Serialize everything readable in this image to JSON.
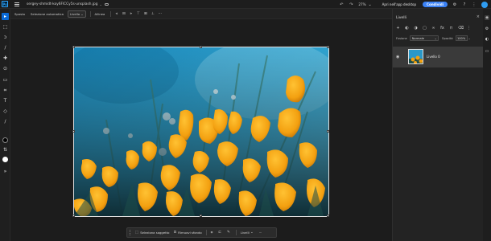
{
  "app": {
    "logo_text": "Ps"
  },
  "document": {
    "title": "sergey-shmidt-koy6FlCCy5s-unsplash.jpg"
  },
  "topbar": {
    "zoom": "27%",
    "desktop_button": "Apri nell'app desktop",
    "share_button": "Condividi"
  },
  "options_bar": {
    "items": [
      {
        "label": "Sposta"
      },
      {
        "label": "Selezione automatica"
      },
      {
        "label": "Livello"
      }
    ],
    "align_label": "Allinea",
    "more": "···"
  },
  "context_bar": {
    "select_subject": "Seleziona soggetto",
    "remove_background": "Rimuovi sfondo",
    "adjustments": "Livelli",
    "more": "···"
  },
  "layers_panel": {
    "title": "Livelli",
    "blend_label": "Fusione",
    "blend_mode": "Normale",
    "opacity_label": "Opacità",
    "opacity_value": "100%",
    "layer_name": "Livello 0"
  },
  "colors": {
    "accent": "#0a6ad6",
    "share": "#3b82f6",
    "foreground_swatch": "#000000",
    "background_swatch": "#ffffff"
  },
  "icons": {
    "toolbar": [
      "move-icon",
      "select-icon",
      "lasso-icon",
      "brush-icon",
      "heal-icon",
      "clone-icon",
      "eraser-icon",
      "crop-icon",
      "type-icon",
      "shape-icon",
      "eyedropper-icon",
      "gradient-icon",
      "fill-icon",
      "more-icon"
    ],
    "rail": [
      "layers-icon",
      "properties-icon",
      "adjustments-icon",
      "comments-icon"
    ]
  }
}
